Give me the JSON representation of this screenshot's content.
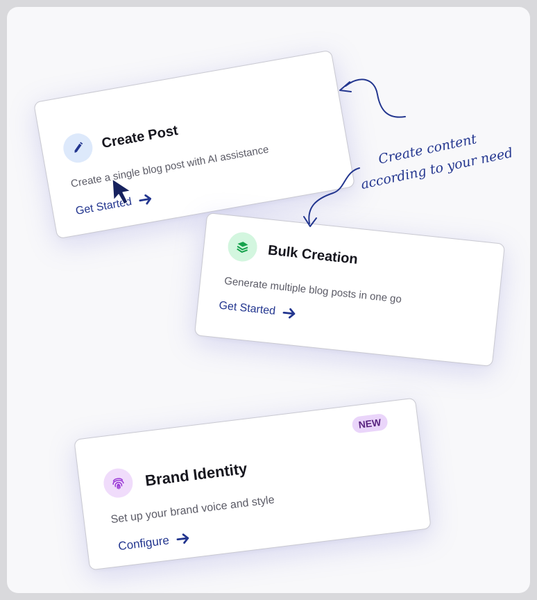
{
  "cards": [
    {
      "title": "Create Post",
      "description": "Create a single blog post with AI assistance",
      "link_label": "Get Started",
      "icon": "pencil-icon",
      "icon_bg": "#dde9fb",
      "icon_color": "#23368f"
    },
    {
      "title": "Bulk Creation",
      "description": "Generate multiple blog posts in one go",
      "link_label": "Get Started",
      "icon": "layers-icon",
      "icon_bg": "#d3f6df",
      "icon_color": "#17a24d"
    },
    {
      "title": "Brand Identity",
      "description": "Set up your brand voice and style",
      "link_label": "Configure",
      "badge": "NEW",
      "icon": "fingerprint-icon",
      "icon_bg": "#f0dcfb",
      "icon_color": "#9a38d6"
    }
  ],
  "annotation": {
    "line1": "Create content",
    "line2": "according to your need"
  },
  "colors": {
    "accent": "#23368f",
    "badge_bg": "#ead5fa",
    "badge_text": "#5a2580"
  }
}
